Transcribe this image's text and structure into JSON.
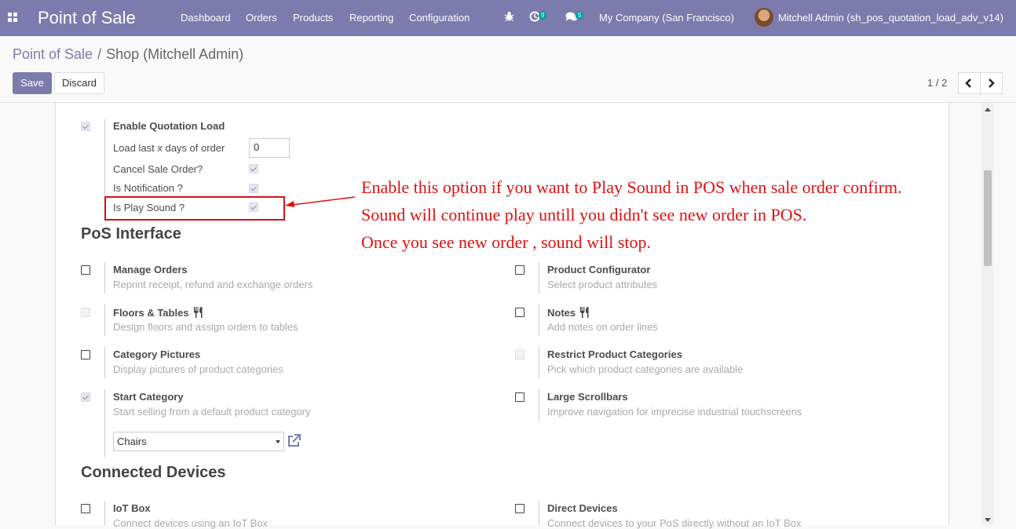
{
  "navbar": {
    "app_title": "Point of Sale",
    "menu": [
      "Dashboard",
      "Orders",
      "Products",
      "Reporting",
      "Configuration"
    ],
    "activity_count": "9",
    "messages_count": "5",
    "company": "My Company (San Francisco)",
    "user": "Mitchell Admin (sh_pos_quotation_load_adv_v14)",
    "icons": [
      "apps-grid-icon",
      "bug-icon",
      "activity-clock-icon",
      "chat-icon"
    ]
  },
  "breadcrumb": {
    "parent": "Point of Sale",
    "separator": "/",
    "current": "Shop (Mitchell Admin)"
  },
  "actions": {
    "save": "Save",
    "discard": "Discard"
  },
  "pager": {
    "value": "1 / 2"
  },
  "quotation": {
    "enable_label": "Enable Quotation Load",
    "enable_checked": true,
    "days_label": "Load last x days of order",
    "days_value": "0",
    "cancel_label": "Cancel Sale Order?",
    "cancel_checked": true,
    "notification_label": "Is Notification ?",
    "notification_checked": true,
    "sound_label": "Is Play Sound ?",
    "sound_checked": true
  },
  "annotation": {
    "line1": "Enable this option if you want to Play Sound in POS when sale order confirm.",
    "line2": "Sound will continue play untill you didn't see new order in POS.",
    "line3": "Once you see new order , sound will stop.",
    "color": "#e01010"
  },
  "pos_interface": {
    "title": "PoS Interface",
    "settings": [
      {
        "title": "Manage Orders",
        "desc": "Reprint receipt, refund and exchange orders",
        "state": "unchecked"
      },
      {
        "title": "Product Configurator",
        "desc": "Select product attributes",
        "state": "unchecked"
      },
      {
        "title": "Floors & Tables",
        "desc": "Design floors and assign orders to tables",
        "state": "disabled",
        "icon": "fork-knife-icon"
      },
      {
        "title": "Notes",
        "desc": "Add notes on order lines",
        "state": "unchecked",
        "icon": "fork-knife-icon"
      },
      {
        "title": "Category Pictures",
        "desc": "Display pictures of product categories",
        "state": "unchecked"
      },
      {
        "title": "Restrict Product Categories",
        "desc": "Pick which product categories are available",
        "state": "disabled"
      },
      {
        "title": "Start Category",
        "desc": "Start selling from a default product category",
        "state": "checked"
      },
      {
        "title": "Large Scrollbars",
        "desc": "Improve navigation for imprecise industrial touchscreens",
        "state": "unchecked"
      }
    ],
    "start_category_value": "Chairs"
  },
  "connected_devices": {
    "title": "Connected Devices",
    "settings": [
      {
        "title": "IoT Box",
        "desc": "Connect devices using an IoT Box",
        "state": "unchecked"
      },
      {
        "title": "Direct Devices",
        "desc": "Connect devices to your PoS directly without an IoT Box",
        "state": "unchecked"
      }
    ]
  },
  "colors": {
    "brand": "#7c7bad",
    "badge": "#00a09d",
    "highlight": "#d21313"
  }
}
